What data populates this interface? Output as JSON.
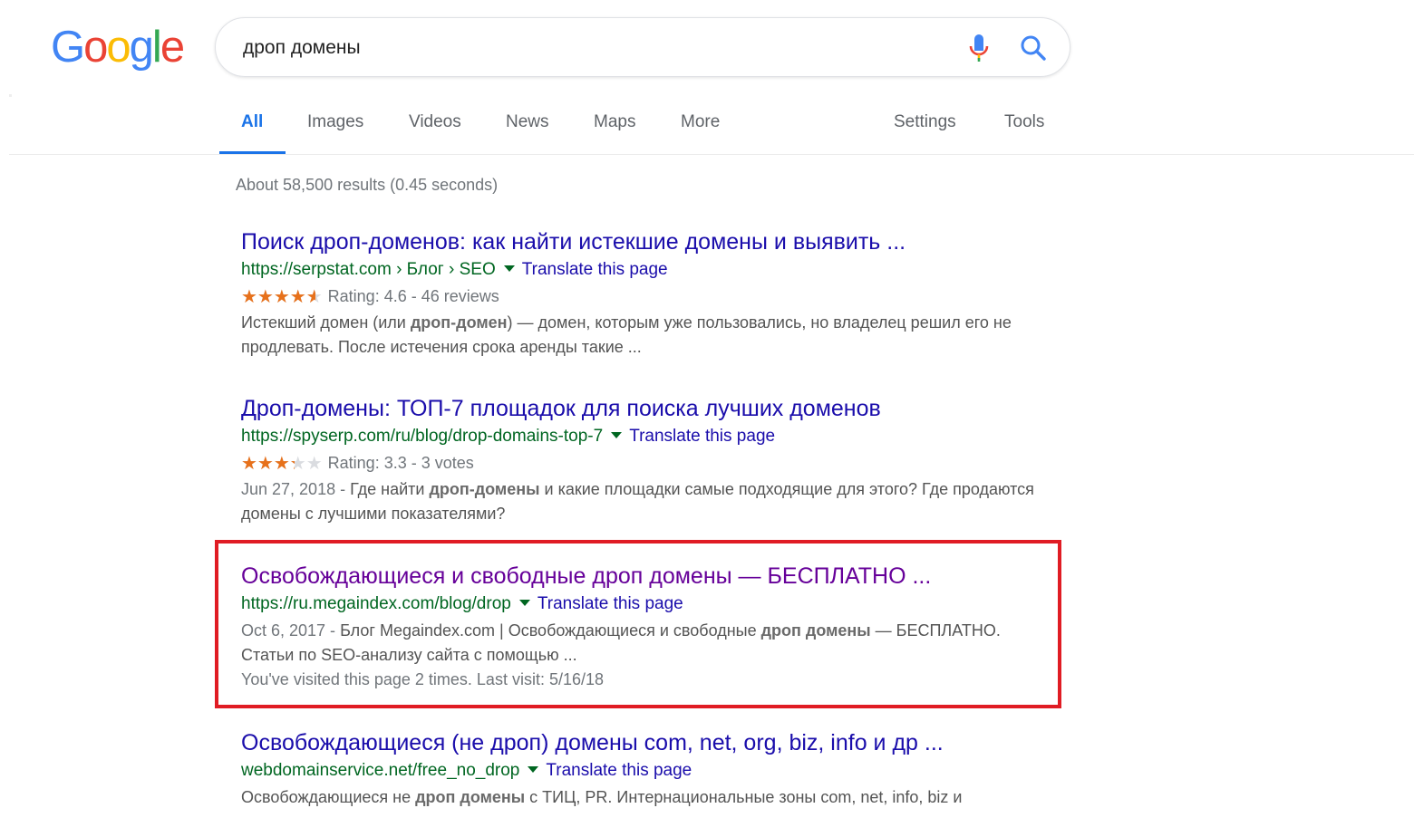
{
  "logo": {
    "text": "Google",
    "colors": [
      "#4285F4",
      "#EA4335",
      "#FBBC05",
      "#4285F4",
      "#34A853",
      "#EA4335"
    ]
  },
  "search": {
    "query": "дроп домены",
    "mic_icon": "microphone-icon",
    "search_icon": "search-icon"
  },
  "tabs": {
    "items": [
      {
        "label": "All",
        "active": true
      },
      {
        "label": "Images"
      },
      {
        "label": "Videos"
      },
      {
        "label": "News"
      },
      {
        "label": "Maps"
      },
      {
        "label": "More"
      }
    ],
    "settings": "Settings",
    "tools": "Tools"
  },
  "stats": "About 58,500 results (0.45 seconds)",
  "results": [
    {
      "title": "Поиск дроп-доменов: как найти истекшие домены и выявить ...",
      "url": "https://serpstat.com › Блог › SEO",
      "translate": "Translate this page",
      "rating_value": 4.6,
      "rating_text": "Rating: 4.6 - 46 reviews",
      "snippet_parts": [
        "Истекший домен (или ",
        "дроп-домен",
        ") — домен, которым уже пользовались, но владелец решил его не продлевать. После истечения срока аренды такие ..."
      ]
    },
    {
      "title": "Дроп-домены: ТОП-7 площадок для поиска лучших доменов",
      "url": "https://spyserp.com/ru/blog/drop-domains-top-7",
      "translate": "Translate this page",
      "rating_value": 3.3,
      "rating_text": "Rating: 3.3 - 3 votes",
      "date": "Jun 27, 2018 - ",
      "snippet_parts": [
        "Где найти ",
        "дроп-домены",
        " и какие площадки самые подходящие для этого? Где продаются домены с лучшими показателями?"
      ]
    },
    {
      "title": "Освобождающиеся и свободные дроп домены — БЕСПЛАТНО ...",
      "url": "https://ru.megaindex.com/blog/drop",
      "translate": "Translate this page",
      "date": "Oct 6, 2017 - ",
      "snippet_parts": [
        "Блог Megaindex.com | Освобождающиеся и свободные ",
        "дроп домены",
        " — БЕСПЛАТНО. Статьи по SEO-анализу сайта с помощью ..."
      ],
      "visit": "You've visited this page 2 times. Last visit: 5/16/18"
    },
    {
      "title": "Освобождающиеся (не дроп) домены com, net, org, biz, info и др ...",
      "url": "webdomainservice.net/free_no_drop",
      "translate": "Translate this page",
      "snippet_parts": [
        "Освобождающиеся не ",
        "дроп домены",
        " с ТИЦ, PR. Интернациональные зоны com, net, info, biz и"
      ]
    }
  ]
}
